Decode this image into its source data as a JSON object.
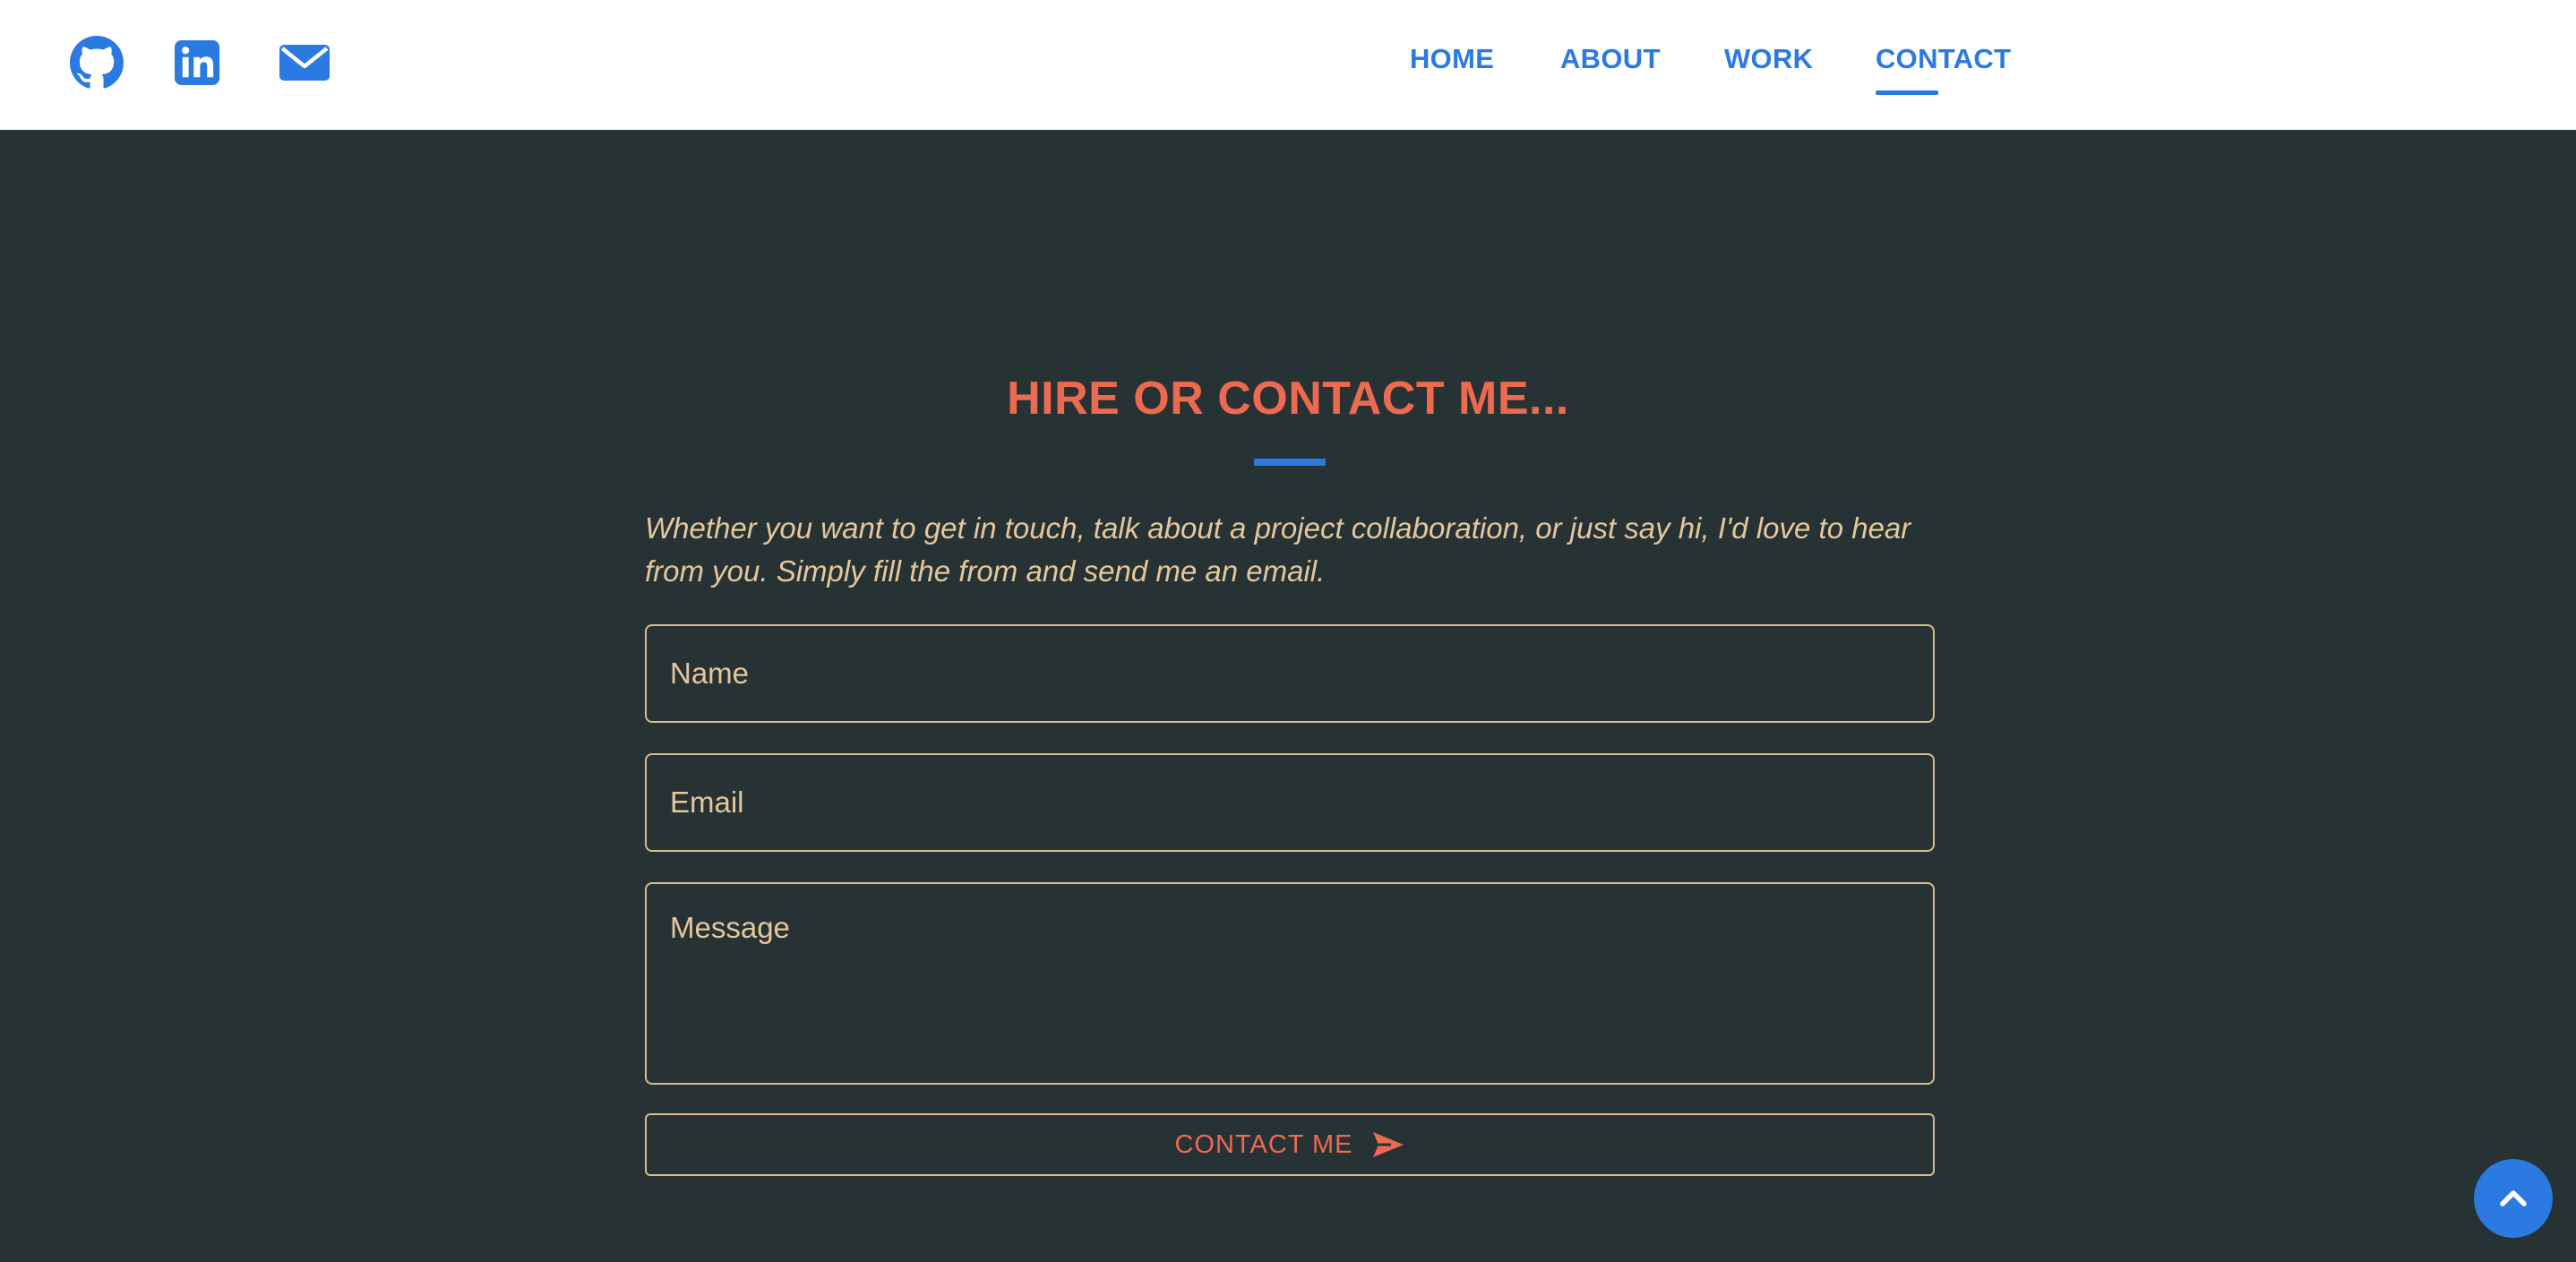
{
  "header": {
    "social": [
      {
        "icon": "github-icon"
      },
      {
        "icon": "linkedin-icon"
      },
      {
        "icon": "envelope-icon"
      }
    ],
    "nav": {
      "home": "HOME",
      "about": "ABOUT",
      "work": "WORK",
      "contact": "CONTACT",
      "active": "contact"
    }
  },
  "contact": {
    "title": "HIRE OR CONTACT ME...",
    "intro": "Whether you want to get in touch, talk about a project collaboration, or just say hi, I'd love to hear from you. Simply fill the from and send me an email.",
    "name_placeholder": "Name",
    "email_placeholder": "Email",
    "message_placeholder": "Message",
    "name_value": "",
    "email_value": "",
    "message_value": "",
    "submit_label": "CONTACT ME",
    "submit_icon": "paper-plane-icon"
  },
  "scroll_top": {
    "icon": "chevron-up-icon"
  },
  "colors": {
    "accent_blue": "#2a7ae2",
    "accent_coral": "#ec6a50",
    "text_tan": "#e6c79c",
    "background": "#263234",
    "header_background": "#ffffff"
  }
}
